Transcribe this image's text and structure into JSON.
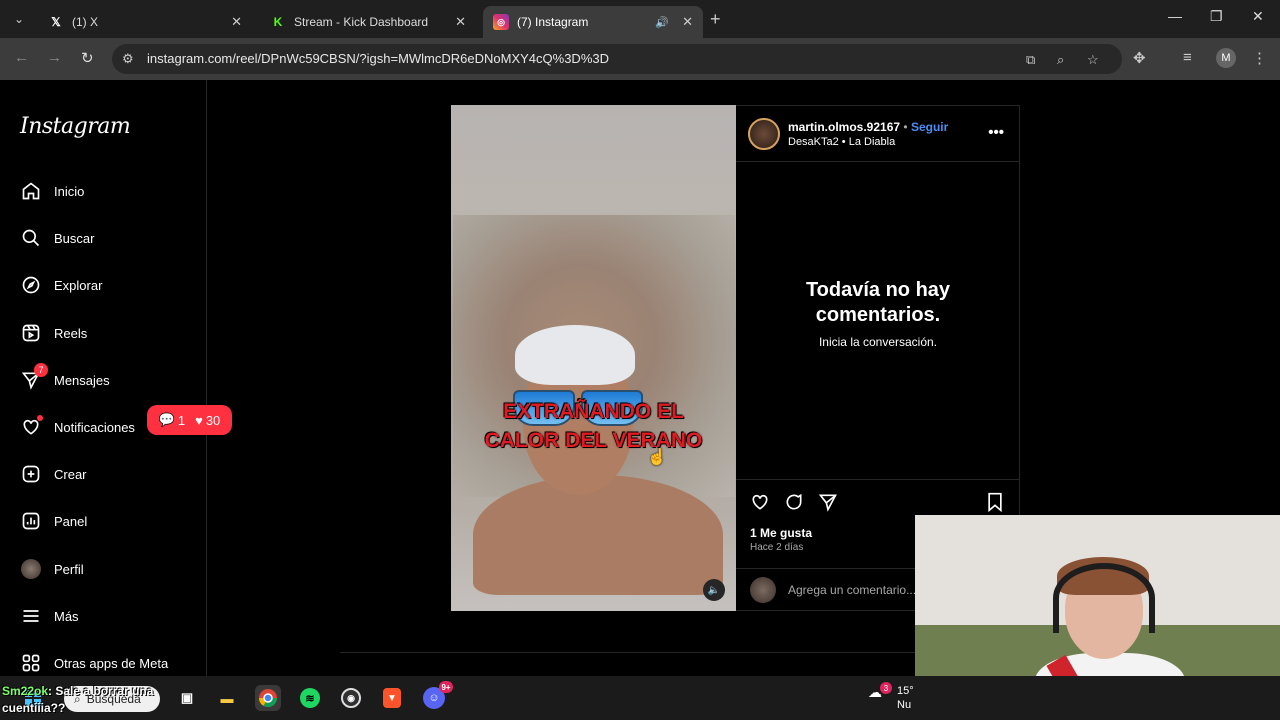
{
  "browser": {
    "tabs": [
      {
        "label": "(1) X",
        "icon": "x-logo-icon"
      },
      {
        "label": "Stream - Kick Dashboard",
        "icon": "kick-logo-icon"
      },
      {
        "label": "(7) Instagram",
        "icon": "instagram-logo-icon",
        "active": true
      }
    ],
    "url": "instagram.com/reel/DPnWc59CBSN/?igsh=MWlmcDR6eDNoMXY4cQ%3D%3D",
    "profile_initial": "M"
  },
  "sidebar": {
    "logo": "Instagram",
    "items": [
      {
        "label": "Inicio",
        "icon": "home-icon"
      },
      {
        "label": "Buscar",
        "icon": "search-icon"
      },
      {
        "label": "Explorar",
        "icon": "compass-icon"
      },
      {
        "label": "Reels",
        "icon": "reels-icon"
      },
      {
        "label": "Mensajes",
        "icon": "messenger-icon",
        "badge": "7"
      },
      {
        "label": "Notificaciones",
        "icon": "heart-icon"
      },
      {
        "label": "Crear",
        "icon": "plus-square-icon"
      },
      {
        "label": "Panel",
        "icon": "dashboard-icon"
      },
      {
        "label": "Perfil",
        "icon": "profile-avatar"
      },
      {
        "label": "Más",
        "icon": "menu-icon"
      },
      {
        "label": "Otras apps de Meta",
        "icon": "meta-apps-icon"
      }
    ],
    "notification_pill": {
      "comments": "1",
      "likes": "30"
    }
  },
  "post": {
    "video_caption_line1": "EXTRAÑANDO EL",
    "video_caption_line2": "CALOR DEL VERANO",
    "username": "martin.olmos.92167",
    "separator": "•",
    "follow_label": "Seguir",
    "subline": "DesaKTa2 • La Diabla",
    "empty_title_line1": "Todavía no hay",
    "empty_title_line2": "comentarios.",
    "empty_sub": "Inicia la conversación.",
    "likes": "1 Me gusta",
    "time": "Hace 2 días",
    "comment_placeholder": "Agrega un comentario..."
  },
  "taskbar": {
    "search_label": "Búsqueda",
    "spotify_badge": "",
    "discord_badge": "9+",
    "weather_badge": "3",
    "weather_text_1": "15°",
    "weather_text_2": "Nu"
  },
  "chat_overlay": {
    "user": "Sm22ok",
    "message_line1": ": Sale a borrar una",
    "message_line2": "cuentiiia??"
  }
}
